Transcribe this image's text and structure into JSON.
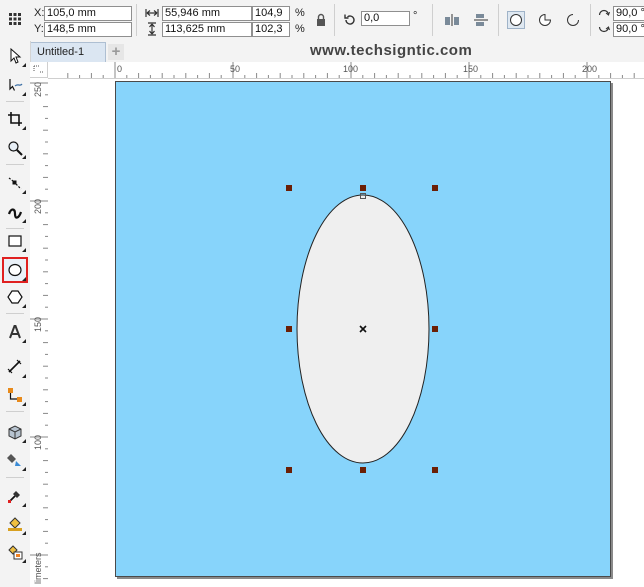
{
  "propbar": {
    "x_label": "X:",
    "x_value": "105,0 mm",
    "y_label": "Y:",
    "y_value": "148,5 mm",
    "width_value": "55,946 mm",
    "height_value": "113,625 mm",
    "scale_x": "104,9",
    "scale_y": "102,3",
    "percent_1": "%",
    "percent_2": "%",
    "rotation_value": "0,0",
    "degree_symbol": "°",
    "angle_start": "90,0 °",
    "angle_end": "90,0 °"
  },
  "tabs": {
    "doc_name": "Untitled-1",
    "add_symbol": "+"
  },
  "watermark": "www.techsigntic.com",
  "ruler": {
    "h_labels": [
      "0",
      "50",
      "100",
      "150",
      "200"
    ],
    "v_labels": [
      "250",
      "200",
      "150",
      "100"
    ],
    "units": "millimeters",
    "units_visible": "limeters"
  },
  "colors": {
    "page_fill": "#87d4fb",
    "ellipse_fill": "#efefef",
    "handle": "#6b1f05",
    "active_tool_outline": "#e02020"
  },
  "icons": {
    "toolbox": [
      "pick-tool-icon",
      "shape-tool-icon",
      "crop-tool-icon",
      "zoom-tool-icon",
      "freehand-tool-icon",
      "artistic-media-icon",
      "rectangle-tool-icon",
      "ellipse-tool-icon",
      "polygon-tool-icon",
      "text-tool-icon",
      "parallel-dimension-icon",
      "connector-icon",
      "interactive-effects-icon",
      "transparency-icon",
      "eyedropper-icon",
      "fill-icon",
      "smart-fill-icon"
    ]
  }
}
